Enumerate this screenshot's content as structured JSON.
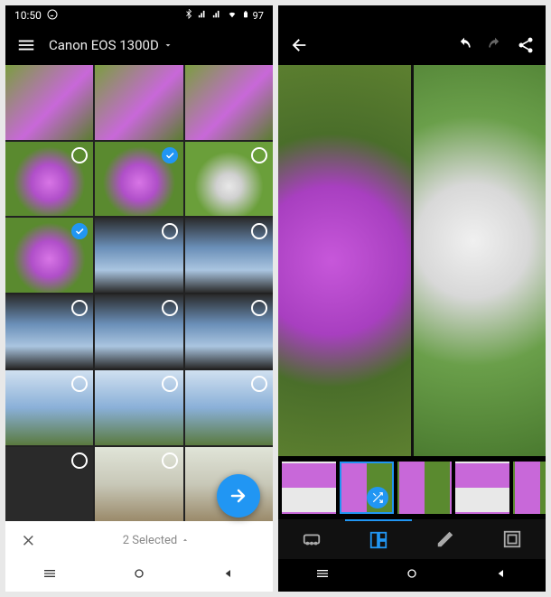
{
  "status": {
    "time": "10:50",
    "battery": "97"
  },
  "left": {
    "title": "Canon EOS 1300D",
    "selection_label": "2 Selected",
    "grid": [
      {
        "kind": "flower1",
        "selected": false,
        "hasSel": false
      },
      {
        "kind": "flower1",
        "selected": false,
        "hasSel": false
      },
      {
        "kind": "flower1",
        "selected": false,
        "hasSel": false
      },
      {
        "kind": "flower2",
        "selected": false,
        "hasSel": true
      },
      {
        "kind": "flower2",
        "selected": true,
        "hasSel": true
      },
      {
        "kind": "flower3",
        "selected": false,
        "hasSel": true
      },
      {
        "kind": "flower2",
        "selected": true,
        "hasSel": true
      },
      {
        "kind": "sky1",
        "selected": false,
        "hasSel": true
      },
      {
        "kind": "sky1",
        "selected": false,
        "hasSel": true
      },
      {
        "kind": "sky1",
        "selected": false,
        "hasSel": true
      },
      {
        "kind": "sky1",
        "selected": false,
        "hasSel": true
      },
      {
        "kind": "sky1",
        "selected": false,
        "hasSel": true
      },
      {
        "kind": "sky2",
        "selected": false,
        "hasSel": true
      },
      {
        "kind": "sky2",
        "selected": false,
        "hasSel": true
      },
      {
        "kind": "sky2",
        "selected": false,
        "hasSel": true
      },
      {
        "kind": "dark",
        "selected": false,
        "hasSel": true
      },
      {
        "kind": "road",
        "selected": false,
        "hasSel": true
      },
      {
        "kind": "road",
        "selected": false,
        "hasSel": false
      }
    ]
  },
  "right": {
    "preview_left": "purple",
    "preview_right": "white",
    "carousel": [
      {
        "layout": "c-layout2",
        "active": false,
        "shuffle": false
      },
      {
        "layout": "c-layout1",
        "active": true,
        "shuffle": true
      },
      {
        "layout": "c-layout1",
        "active": false,
        "shuffle": false
      },
      {
        "layout": "c-layout2",
        "active": false,
        "shuffle": false
      },
      {
        "layout": "c-layout1",
        "active": false,
        "shuffle": false
      }
    ],
    "tabs": [
      "aspect",
      "layout",
      "edit",
      "border"
    ],
    "active_tab": "layout"
  },
  "icons": {
    "menu": "menu-icon",
    "dropdown": "chevron-down-icon",
    "back": "arrow-left-icon",
    "undo": "undo-icon",
    "redo": "redo-icon",
    "share": "share-icon",
    "close": "close-icon",
    "next": "arrow-right-icon",
    "shuffle": "shuffle-icon"
  }
}
